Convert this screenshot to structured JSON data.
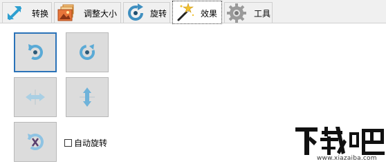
{
  "tabs": [
    {
      "label": "转换",
      "icon": "resize-arrow-icon"
    },
    {
      "label": "调整大小",
      "icon": "image-resize-icon"
    },
    {
      "label": "旋转",
      "icon": "rotate-icon"
    },
    {
      "label": "效果",
      "icon": "magic-wand-icon",
      "active": true
    },
    {
      "label": "工具",
      "icon": "gear-icon"
    }
  ],
  "effects": {
    "buttons": [
      {
        "name": "rotate-left",
        "icon": "rotate-left-icon"
      },
      {
        "name": "rotate-right",
        "icon": "rotate-right-icon"
      },
      {
        "name": "flip-horizontal",
        "icon": "flip-horizontal-icon"
      },
      {
        "name": "flip-vertical",
        "icon": "flip-vertical-icon"
      },
      {
        "name": "reset-rotation",
        "icon": "reset-rotation-icon"
      }
    ],
    "auto_rotate_label": "自动旋转",
    "auto_rotate_checked": false
  },
  "watermark": {
    "logo_text": "下载吧",
    "url": "www.xiazaiba.com"
  },
  "colors": {
    "accent": "#2a72b8",
    "icon_blue": "#4a9cc9",
    "icon_light": "#a9cfe4"
  }
}
